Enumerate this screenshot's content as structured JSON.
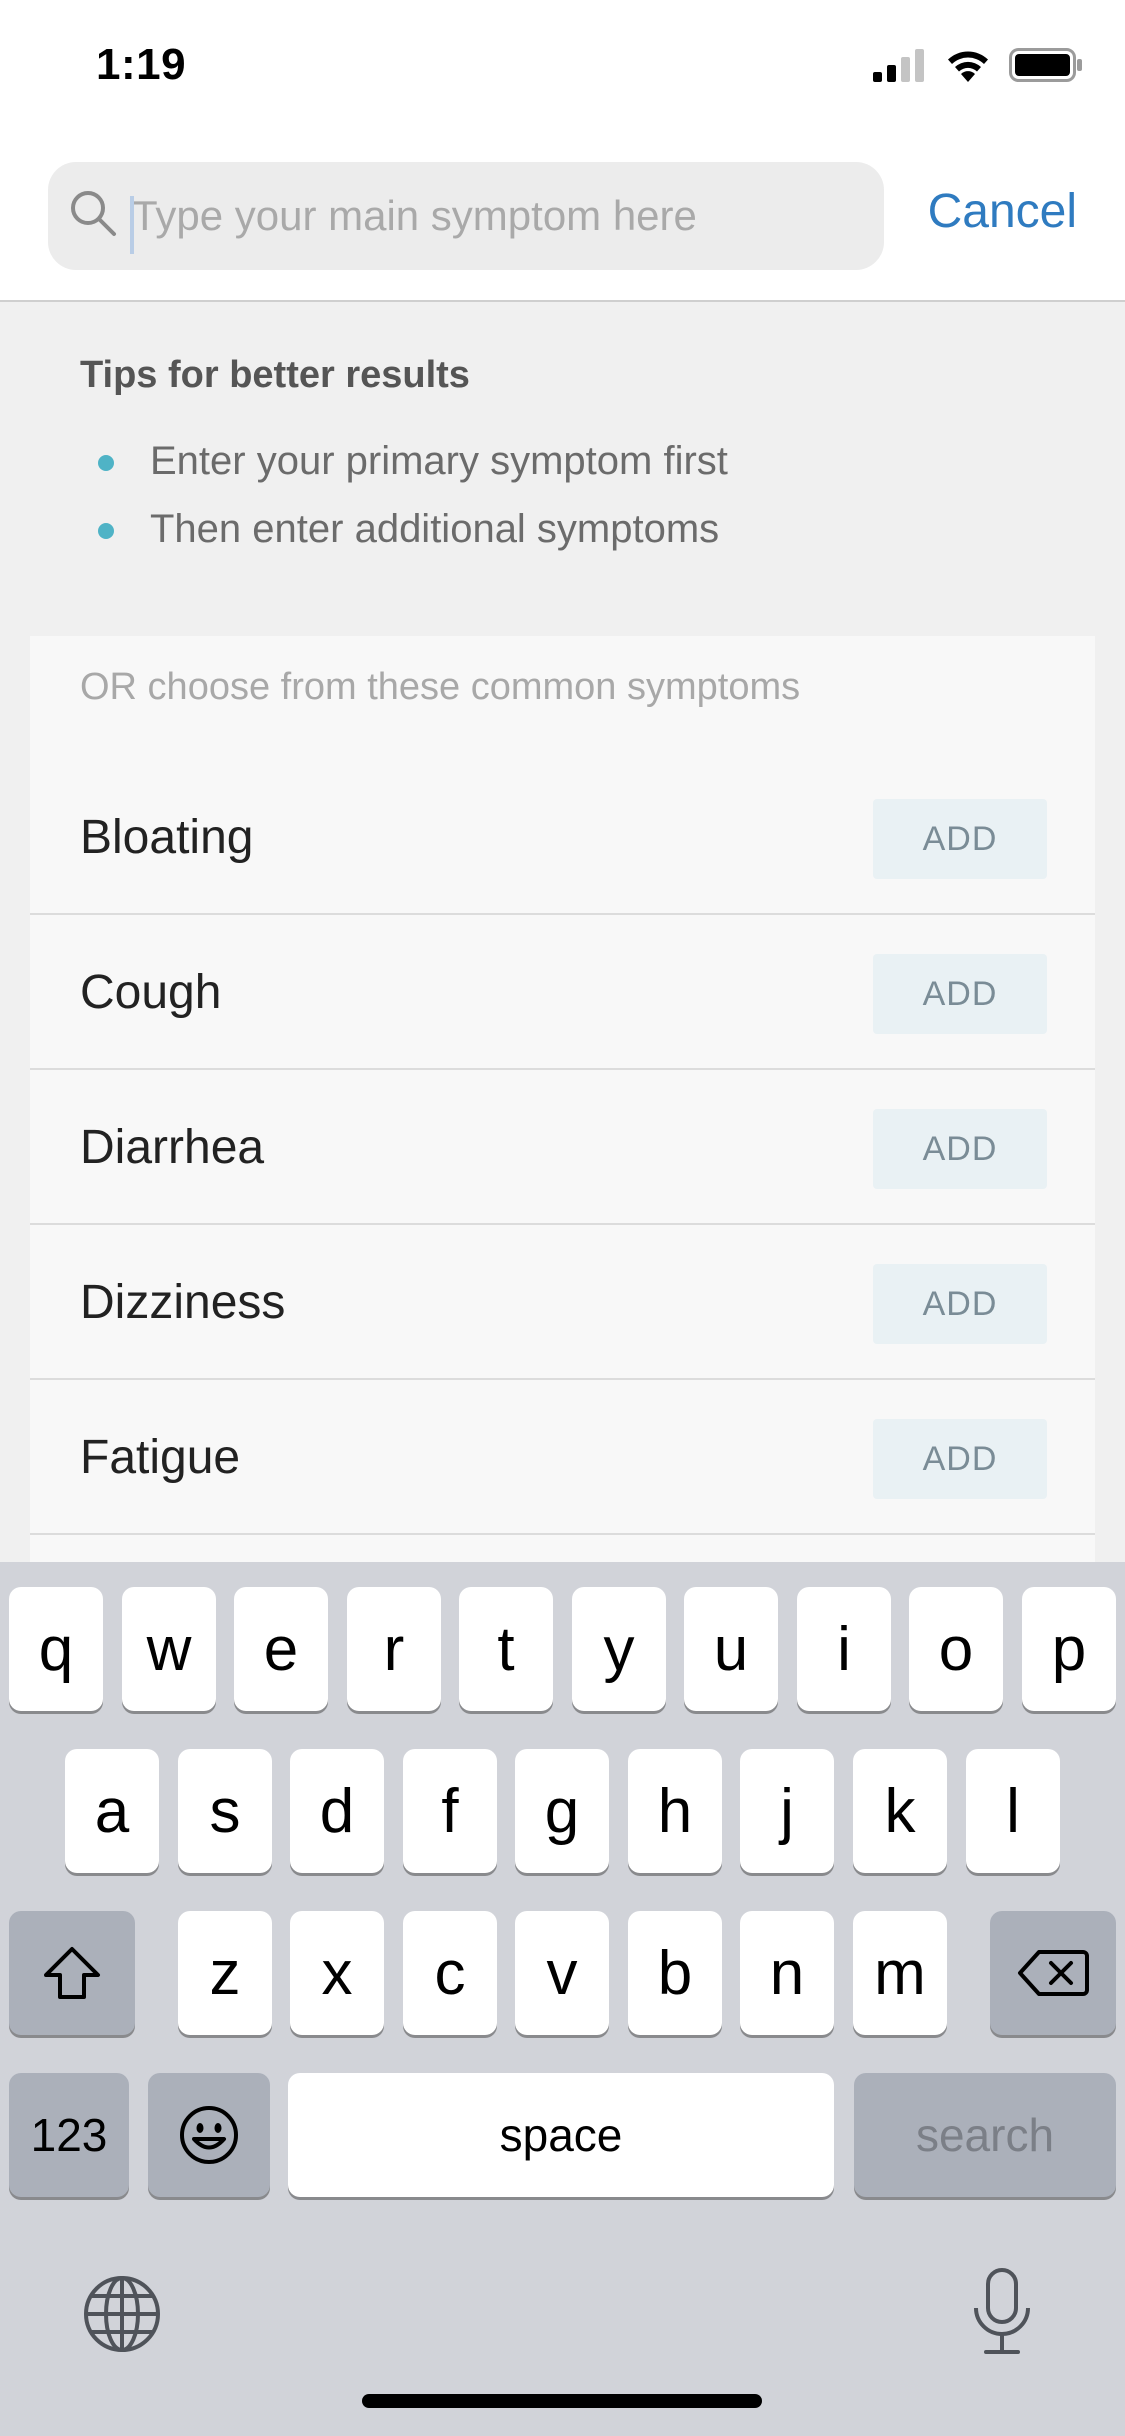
{
  "status_bar": {
    "time": "1:19"
  },
  "search": {
    "placeholder": "Type your main symptom here",
    "value": "",
    "cancel_label": "Cancel"
  },
  "tips": {
    "title": "Tips for better results",
    "items": [
      "Enter your primary symptom first",
      "Then enter additional symptoms"
    ]
  },
  "common": {
    "title": "OR choose from these common symptoms",
    "add_label": "ADD",
    "items": [
      "Bloating",
      "Cough",
      "Diarrhea",
      "Dizziness",
      "Fatigue"
    ]
  },
  "keyboard": {
    "row1": [
      "q",
      "w",
      "e",
      "r",
      "t",
      "y",
      "u",
      "i",
      "o",
      "p"
    ],
    "row2": [
      "a",
      "s",
      "d",
      "f",
      "g",
      "h",
      "j",
      "k",
      "l"
    ],
    "row3": [
      "z",
      "x",
      "c",
      "v",
      "b",
      "n",
      "m"
    ],
    "numbers_label": "123",
    "space_label": "space",
    "search_label": "search"
  },
  "colors": {
    "accent": "#2f7bc0",
    "bullet": "#4fb3c6",
    "add_bg": "#e9f1f4"
  }
}
